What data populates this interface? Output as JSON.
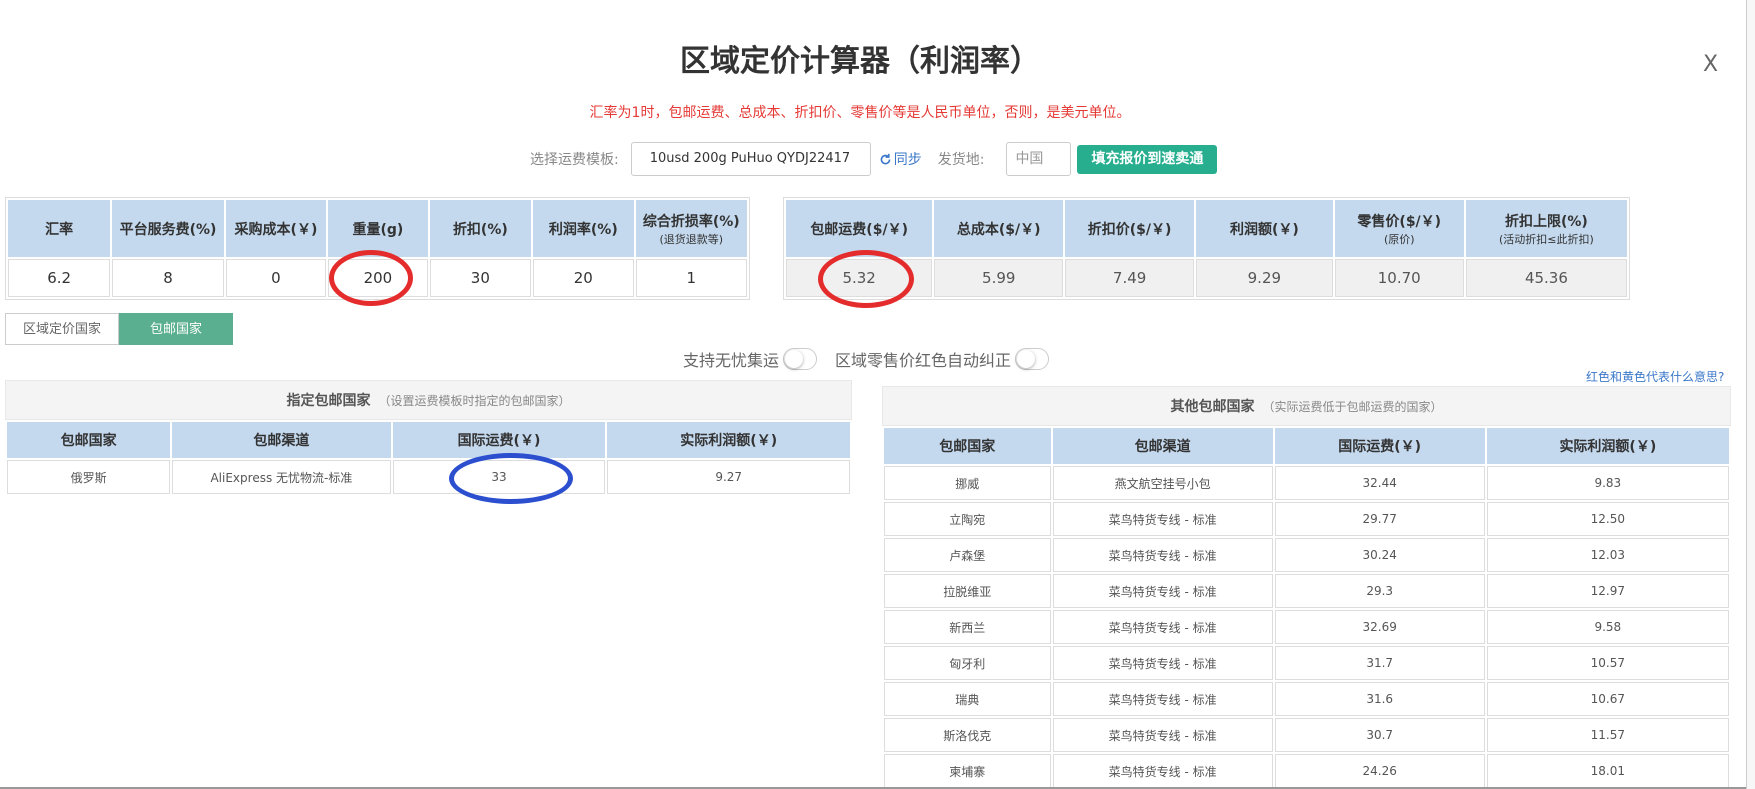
{
  "title": "区域定价计算器（利润率）",
  "close_label": "X",
  "note": "汇率为1时，包邮运费、总成本、折扣价、零售价等是人民币单位，否则，是美元单位。",
  "template": {
    "label": "选择运费模板:",
    "value": "10usd 200g PuHuo QYDJ22417",
    "sync": "同步",
    "origin_label": "发货地:",
    "origin_value": "中国",
    "fill_button": "填充报价到速卖通"
  },
  "params": {
    "headers": [
      {
        "label": "汇率",
        "sub": ""
      },
      {
        "label": "平台服务费(%)",
        "sub": ""
      },
      {
        "label": "采购成本(￥)",
        "sub": ""
      },
      {
        "label": "重量(g)",
        "sub": ""
      },
      {
        "label": "折扣(%)",
        "sub": ""
      },
      {
        "label": "利润率(%)",
        "sub": ""
      },
      {
        "label": "综合折损率(%)",
        "sub": "(退货退款等)"
      }
    ],
    "values": [
      "6.2",
      "8",
      "0",
      "200",
      "30",
      "20",
      "1"
    ]
  },
  "results": {
    "headers": [
      {
        "label": "包邮运费($/￥)",
        "sub": ""
      },
      {
        "label": "总成本($/￥)",
        "sub": ""
      },
      {
        "label": "折扣价($/￥)",
        "sub": ""
      },
      {
        "label": "利润额(￥)",
        "sub": ""
      },
      {
        "label": "零售价($/￥)",
        "sub": "(原价)"
      },
      {
        "label": "折扣上限(%)",
        "sub": "(活动折扣≤此折扣)"
      }
    ],
    "values": [
      "5.32",
      "5.99",
      "7.49",
      "9.29",
      "10.70",
      "45.36"
    ]
  },
  "tabs": [
    "区域定价国家",
    "包邮国家"
  ],
  "toggles": [
    "支持无忧集运",
    "区域零售价红色自动纠正"
  ],
  "legend_link": "红色和黄色代表什么意思?",
  "designated": {
    "title": "指定包邮国家",
    "hint": "（设置运费模板时指定的包邮国家）",
    "columns": [
      "包邮国家",
      "包邮渠道",
      "国际运费(￥)",
      "实际利润额(￥)"
    ],
    "rows": [
      [
        "俄罗斯",
        "AliExpress 无忧物流-标准",
        "33",
        "9.27"
      ]
    ]
  },
  "others": {
    "title": "其他包邮国家",
    "hint": "（实际运费低于包邮运费的国家）",
    "columns": [
      "包邮国家",
      "包邮渠道",
      "国际运费(￥)",
      "实际利润额(￥)"
    ],
    "rows": [
      [
        "挪威",
        "燕文航空挂号小包",
        "32.44",
        "9.83"
      ],
      [
        "立陶宛",
        "菜鸟特货专线 - 标准",
        "29.77",
        "12.50"
      ],
      [
        "卢森堡",
        "菜鸟特货专线 - 标准",
        "30.24",
        "12.03"
      ],
      [
        "拉脱维亚",
        "菜鸟特货专线 - 标准",
        "29.3",
        "12.97"
      ],
      [
        "新西兰",
        "菜鸟特货专线 - 标准",
        "32.69",
        "9.58"
      ],
      [
        "匈牙利",
        "菜鸟特货专线 - 标准",
        "31.7",
        "10.57"
      ],
      [
        "瑞典",
        "菜鸟特货专线 - 标准",
        "31.6",
        "10.67"
      ],
      [
        "斯洛伐克",
        "菜鸟特货专线 - 标准",
        "30.7",
        "11.57"
      ],
      [
        "柬埔寨",
        "菜鸟特货专线 - 标准",
        "24.26",
        "18.01"
      ]
    ]
  },
  "colors": {
    "accent_green": "#27ae8f",
    "tab_active": "#5aaf91",
    "header_blue": "#c4d9ee",
    "note_red": "#e53935",
    "ring_red": "#e52c2c",
    "ring_blue": "#2b4fcf"
  }
}
